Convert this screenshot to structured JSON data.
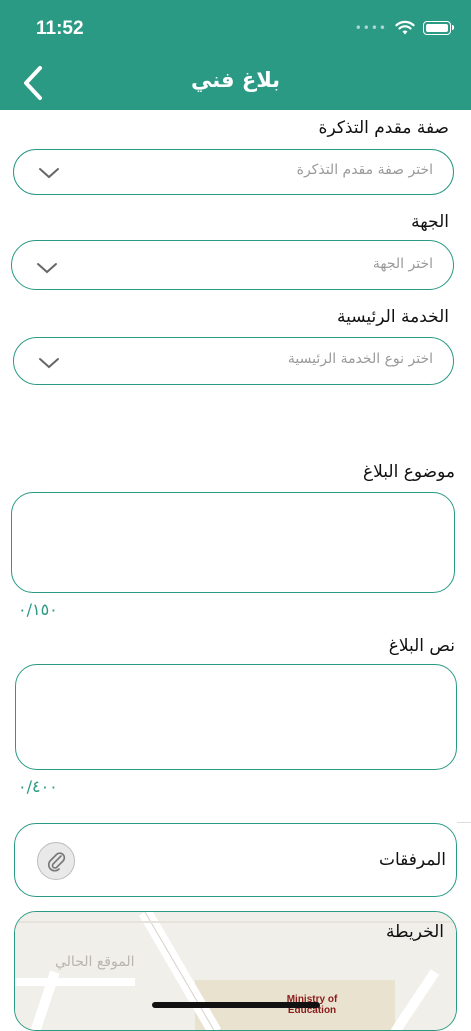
{
  "status_bar": {
    "time": "11:52"
  },
  "header": {
    "title": "بلاغ فني"
  },
  "form": {
    "applicant_type": {
      "label": "صفة مقدم التذكرة",
      "placeholder": "اختر صفة مقدم التذكرة"
    },
    "entity": {
      "label": "الجهة",
      "placeholder": "اختر الجهة"
    },
    "main_service": {
      "label": "الخدمة الرئيسية",
      "placeholder": "اختر نوع الخدمة الرئيسية"
    },
    "subject": {
      "label": "موضوع البلاغ",
      "counter": "٠/١٥٠"
    },
    "body": {
      "label": "نص البلاغ",
      "counter": "٠/٤٠٠"
    },
    "attachments": {
      "label": "المرفقات"
    },
    "map": {
      "label": "الخريطة",
      "current_location": "الموقع الحالي",
      "place_label": "Ministry of Education"
    }
  },
  "colors": {
    "accent": "#2a9a84"
  },
  "icons": {
    "back": "chevron-left-icon",
    "dropdown": "chevron-down-icon",
    "attach": "paperclip-icon",
    "wifi": "wifi-icon",
    "battery": "battery-icon"
  }
}
